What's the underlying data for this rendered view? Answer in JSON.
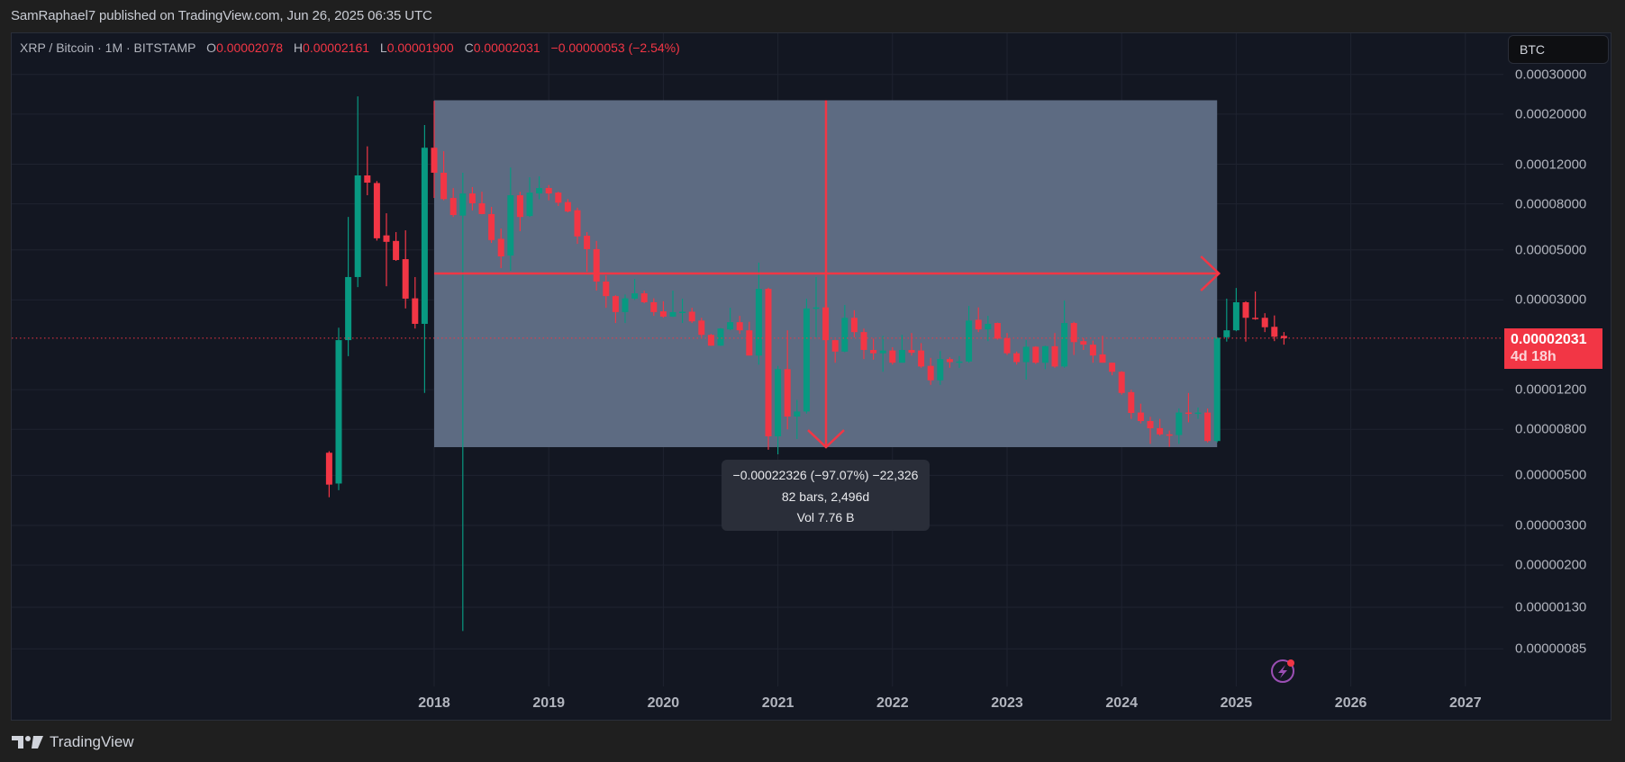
{
  "header": {
    "published": "SamRaphael7 published on TradingView.com, Jun 26, 2025 06:35 UTC"
  },
  "legend": {
    "symbol": "XRP / Bitcoin · 1M · BITSTAMP",
    "open_label": "O",
    "open": "0.00002078",
    "high_label": "H",
    "high": "0.00002161",
    "low_label": "L",
    "low": "0.00001900",
    "close_label": "C",
    "close": "0.00002031",
    "change": "−0.00000053 (−2.54%)"
  },
  "currency_button": "BTC",
  "current_price": {
    "value": "0.00002031",
    "countdown": "4d 18h"
  },
  "measure_tooltip": {
    "line1": "−0.00022326 (−97.07%) −22,326",
    "line2": "82 bars, 2,496d",
    "line3": "Vol 7.76 B"
  },
  "footer": {
    "brand": "TradingView"
  },
  "colors": {
    "up": "#089981",
    "down": "#f23645",
    "measure_fill": "#5d6b82",
    "background": "#131722"
  },
  "chart_data": {
    "type": "candlestick",
    "title": "XRP / Bitcoin · 1M · BITSTAMP",
    "scale": "log",
    "start_month": "2017-02",
    "interval": "1M",
    "ylabel": "BTC",
    "y_ticks": [
      "0.00030000",
      "0.00020000",
      "0.00012000",
      "0.00008000",
      "0.00005000",
      "0.00003000",
      "0.00001200",
      "0.00000800",
      "0.00000500",
      "0.00000300",
      "0.00000200",
      "0.00000130",
      "0.00000085"
    ],
    "x_ticks": [
      "2018",
      "2019",
      "2020",
      "2021",
      "2022",
      "2023",
      "2024",
      "2025",
      "2026",
      "2027"
    ],
    "current_price": 2.031e-05,
    "measure": {
      "start": "2018-01",
      "end": "2024-11",
      "high": 0.00023053,
      "low": 6.67e-06
    },
    "ohlc": [
      [
        6.3e-06,
        6.4e-06,
        4e-06,
        4.55e-06
      ],
      [
        4.6e-06,
        2.26e-05,
        4.3e-06,
        1.99e-05
      ],
      [
        1.99e-05,
        7e-05,
        1.69e-05,
        3.79e-05
      ],
      [
        3.79e-05,
        0.00024,
        3.42e-05,
        0.000107
      ],
      [
        0.000107,
        0.000144,
        8.74e-05,
        9.94e-05
      ],
      [
        9.9e-05,
        0.000101,
        5.5e-05,
        5.63e-05
      ],
      [
        5.8e-05,
        7.27e-05,
        3.45e-05,
        5.43e-05
      ],
      [
        5.48e-05,
        6e-05,
        4.47e-05,
        4.51e-05
      ],
      [
        4.55e-05,
        6.11e-05,
        2.75e-05,
        3.04e-05
      ],
      [
        3.05e-05,
        3.79e-05,
        2.24e-05,
        2.35e-05
      ],
      [
        2.35e-05,
        0.000179,
        1.16e-05,
        0.000142
      ],
      [
        0.000142,
        0.000229,
        8.5e-05,
        0.00011
      ],
      [
        0.00011,
        0.000137,
        8.3e-05,
        8.4e-05
      ],
      [
        8.5e-05,
        9.4e-05,
        7e-05,
        7.14e-05
      ],
      [
        7.1e-05,
        0.00011,
        1.02e-06,
        8.9e-05
      ],
      [
        8.9e-05,
        9.5e-05,
        7.48e-05,
        8.05e-05
      ],
      [
        8.05e-05,
        9.06e-05,
        7.2e-05,
        7.21e-05
      ],
      [
        7.21e-05,
        7.76e-05,
        5.37e-05,
        5.53e-05
      ],
      [
        5.6e-05,
        6.22e-05,
        4.15e-05,
        4.68e-05
      ],
      [
        4.72e-05,
        0.000116,
        4.04e-05,
        8.74e-05
      ],
      [
        8.74e-05,
        9.06e-05,
        6.05e-05,
        7e-05
      ],
      [
        7.07e-05,
        0.000105,
        7e-05,
        8.98e-05
      ],
      [
        8.9e-05,
        0.000106,
        8.38e-05,
        9.41e-05
      ],
      [
        9.41e-05,
        9.7e-05,
        8.3e-05,
        8.9e-05
      ],
      [
        8.98e-05,
        9.06e-05,
        7.83e-05,
        8.1e-05
      ],
      [
        8.15e-05,
        8.4e-05,
        7.34e-05,
        7.4e-05
      ],
      [
        7.5e-05,
        7.7e-05,
        5.32e-05,
        5.74e-05
      ],
      [
        5.78e-05,
        6e-05,
        4e-05,
        5.04e-05
      ],
      [
        5.04e-05,
        5.48e-05,
        3.3e-05,
        3.62e-05
      ],
      [
        3.62e-05,
        3.86e-05,
        2.77e-05,
        3.12e-05
      ],
      [
        3.12e-05,
        3.15e-05,
        2.37e-05,
        2.65e-05
      ],
      [
        2.65e-05,
        3.17e-05,
        2.37e-05,
        3.05e-05
      ],
      [
        3.04e-05,
        3.72e-05,
        3e-05,
        3.21e-05
      ],
      [
        3.21e-05,
        3.3e-05,
        2.9e-05,
        2.93e-05
      ],
      [
        2.93e-05,
        3.05e-05,
        2.55e-05,
        2.65e-05
      ],
      [
        2.67e-05,
        2.96e-05,
        2.5e-05,
        2.53e-05
      ],
      [
        2.53e-05,
        3.3e-05,
        2.52e-05,
        2.65e-05
      ],
      [
        2.65e-05,
        3.04e-05,
        2.37e-05,
        2.66e-05
      ],
      [
        2.66e-05,
        2.77e-05,
        2.37e-05,
        2.41e-05
      ],
      [
        2.43e-05,
        2.5e-05,
        2.05e-05,
        2.1e-05
      ],
      [
        2.1e-05,
        2.12e-05,
        1.88e-05,
        1.88e-05
      ],
      [
        1.88e-05,
        2.25e-05,
        1.88e-05,
        2.24e-05
      ],
      [
        2.22e-05,
        2.77e-05,
        2.2e-05,
        2.39e-05
      ],
      [
        2.39e-05,
        2.55e-05,
        2.12e-05,
        2.2e-05
      ],
      [
        2.2e-05,
        2.4e-05,
        1.7e-05,
        1.7e-05
      ],
      [
        1.7e-05,
        4.39e-05,
        1.55e-05,
        3.36e-05
      ],
      [
        3.36e-05,
        3.4e-05,
        6.5e-06,
        7.45e-06
      ],
      [
        7.45e-06,
        1.53e-05,
        6.2e-06,
        1.48e-05
      ],
      [
        1.48e-05,
        2.2e-05,
        8e-06,
        9.12e-06
      ],
      [
        9.12e-06,
        1.08e-05,
        7.25e-06,
        9.6e-06
      ],
      [
        9.6e-06,
        3.04e-05,
        9.4e-06,
        2.75e-05
      ],
      [
        2.75e-05,
        3.79e-05,
        2.05e-05,
        2.78e-05
      ],
      [
        2.78e-05,
        2.8e-05,
        1.95e-05,
        1.99e-05
      ],
      [
        1.99e-05,
        2e-05,
        1.58e-05,
        1.77e-05
      ],
      [
        1.77e-05,
        2.85e-05,
        1.76e-05,
        2.5e-05
      ],
      [
        2.5e-05,
        2.7e-05,
        2.05e-05,
        2.16e-05
      ],
      [
        2.16e-05,
        2.24e-05,
        1.64e-05,
        1.8e-05
      ],
      [
        1.8e-05,
        2.02e-05,
        1.63e-05,
        1.74e-05
      ],
      [
        1.74e-05,
        2.08e-05,
        1.44e-05,
        1.79e-05
      ],
      [
        1.79e-05,
        1.85e-05,
        1.55e-05,
        1.58e-05
      ],
      [
        1.58e-05,
        2.1e-05,
        1.58e-05,
        1.8e-05
      ],
      [
        1.8e-05,
        2.14e-05,
        1.7e-05,
        1.75e-05
      ],
      [
        1.79e-05,
        1.93e-05,
        1.5e-05,
        1.52e-05
      ],
      [
        1.53e-05,
        1.66e-05,
        1.26e-05,
        1.32e-05
      ],
      [
        1.32e-05,
        1.78e-05,
        1.26e-05,
        1.64e-05
      ],
      [
        1.64e-05,
        1.67e-05,
        1.5e-05,
        1.59e-05
      ],
      [
        1.59e-05,
        1.69e-05,
        1.5e-05,
        1.6e-05
      ],
      [
        1.6e-05,
        2.82e-05,
        1.58e-05,
        2.43e-05
      ],
      [
        2.45e-05,
        2.78e-05,
        2.16e-05,
        2.22e-05
      ],
      [
        2.22e-05,
        2.55e-05,
        1.97e-05,
        2.35e-05
      ],
      [
        2.37e-05,
        2.38e-05,
        2e-05,
        2.02e-05
      ],
      [
        2.03e-05,
        2.14e-05,
        1.71e-05,
        1.74e-05
      ],
      [
        1.74e-05,
        1.77e-05,
        1.55e-05,
        1.59e-05
      ],
      [
        1.59e-05,
        1.99e-05,
        1.33e-05,
        1.86e-05
      ],
      [
        1.86e-05,
        1.87e-05,
        1.56e-05,
        1.58e-05
      ],
      [
        1.58e-05,
        1.88e-05,
        1.48e-05,
        1.87e-05
      ],
      [
        1.87e-05,
        2.14e-05,
        1.5e-05,
        1.52e-05
      ],
      [
        1.52e-05,
        2.98e-05,
        1.5e-05,
        2.37e-05
      ],
      [
        2.37e-05,
        2.4e-05,
        1.71e-05,
        1.95e-05
      ],
      [
        1.97e-05,
        2.03e-05,
        1.8e-05,
        1.9e-05
      ],
      [
        1.9e-05,
        1.98e-05,
        1.58e-05,
        1.7e-05
      ],
      [
        1.72e-05,
        2.08e-05,
        1.58e-05,
        1.58e-05
      ],
      [
        1.58e-05,
        1.58e-05,
        1.39e-05,
        1.44e-05
      ],
      [
        1.44e-05,
        1.45e-05,
        1.14e-05,
        1.16e-05
      ],
      [
        1.17e-05,
        1.2e-05,
        8.9e-06,
        9.46e-06
      ],
      [
        9.5e-06,
        1.04e-05,
        8.5e-06,
        8.71e-06
      ],
      [
        8.71e-06,
        9.1e-06,
        6.9e-06,
        8.09e-06
      ],
      [
        8.1e-06,
        8.9e-06,
        7.5e-06,
        7.6e-06
      ],
      [
        7.6e-06,
        7.9e-06,
        6.7e-06,
        7.55e-06
      ],
      [
        7.55e-06,
        9.9e-06,
        6.9e-06,
        9.5e-06
      ],
      [
        9.5e-06,
        1.16e-05,
        8.6e-06,
        9.45e-06
      ],
      [
        9.45e-06,
        1e-05,
        8.9e-06,
        9.5e-06
      ],
      [
        9.5e-06,
        9.9e-06,
        7e-06,
        7.1e-06
      ],
      [
        7.1e-06,
        2.05e-05,
        7e-06,
        2.04e-05
      ],
      [
        2.05e-05,
        3.04e-05,
        1.96e-05,
        2.2e-05
      ],
      [
        2.2e-05,
        3.39e-05,
        2.18e-05,
        2.93e-05
      ],
      [
        2.93e-05,
        2.96e-05,
        1.96e-05,
        2.5e-05
      ],
      [
        2.5e-05,
        3.27e-05,
        2.45e-05,
        2.49e-05
      ],
      [
        2.5e-05,
        2.62e-05,
        2.16e-05,
        2.27e-05
      ],
      [
        2.28e-05,
        2.56e-05,
        1.97e-05,
        2.06e-05
      ],
      [
        2.078e-05,
        2.161e-05,
        1.9e-05,
        2.031e-05
      ]
    ]
  }
}
